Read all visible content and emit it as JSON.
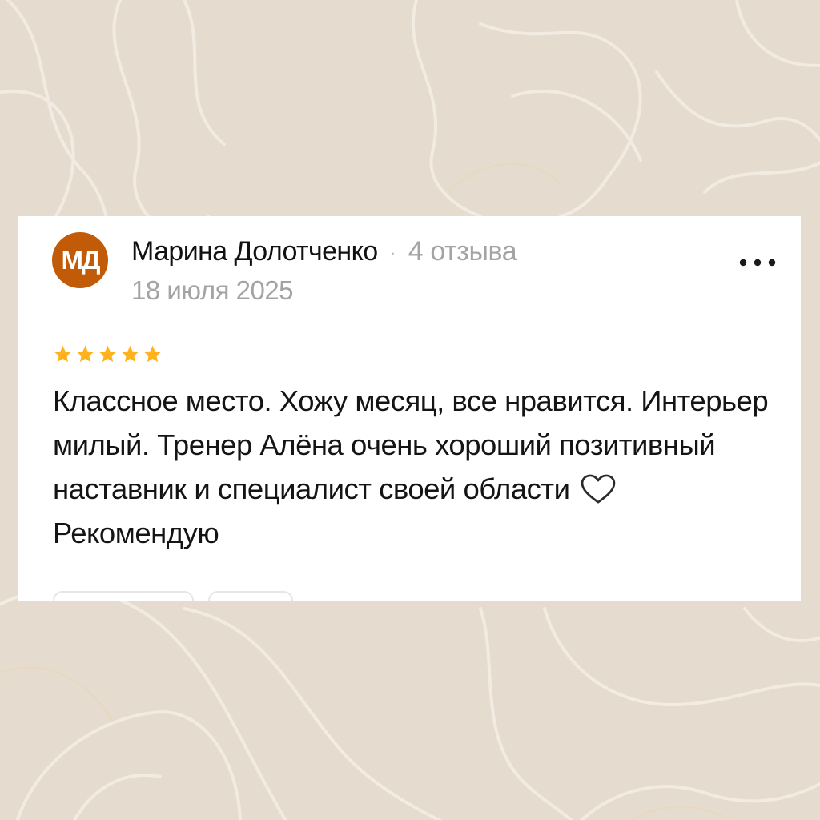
{
  "review": {
    "avatar_initials": "МД",
    "author_name": "Марина Долотченко",
    "separator": "·",
    "review_count": "4 отзыва",
    "date": "18 июля 2025",
    "rating": 5,
    "rating_max": 5,
    "text_before_icon": "Классное место. Хожу месяц, все нравится. Интерьер милый. Тренер Алёна очень хороший позитивный наставник и специалист своей области",
    "text_after_icon": "Рекомендую",
    "inline_icon": "heart-outline-icon",
    "menu_icon": "more-horizontal-icon"
  },
  "colors": {
    "background": "#e6dbcf",
    "background_lines": "#f4ede3",
    "card": "#ffffff",
    "avatar": "#c25b07",
    "star": "#ffb21c",
    "text_primary": "#141414",
    "text_secondary": "#a4a4a4"
  }
}
